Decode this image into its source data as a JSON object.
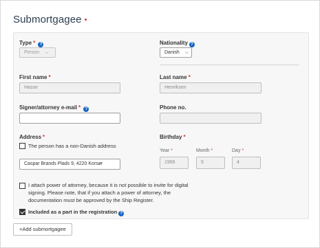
{
  "section": {
    "title": "Submortgagee",
    "required_mark": "•"
  },
  "required_mark": "*",
  "type": {
    "label": "Type",
    "value": "Person",
    "help_icon": "?"
  },
  "nationality": {
    "label": "Nationality",
    "value": "Danish",
    "help_icon": "?"
  },
  "first_name": {
    "label": "First name",
    "value": "Hasse"
  },
  "last_name": {
    "label": "Last name",
    "value": "Henriksen"
  },
  "signer_email": {
    "label": "Signer/attorney e-mail",
    "value": "",
    "help_icon": "?"
  },
  "phone": {
    "label": "Phone no.",
    "value": ""
  },
  "address": {
    "label": "Address",
    "non_danish_label": "The person has a non-Danish address",
    "non_danish_checked": false,
    "value": "Caspar Brands Plads 9, 4220 Korsør"
  },
  "birthday": {
    "label": "Birthday",
    "year_label": "Year",
    "year": "1966",
    "month_label": "Month",
    "month": "5",
    "day_label": "Day",
    "day": "4"
  },
  "power_of_attorney": {
    "checked": false,
    "lines": [
      "I attach power of attorney, because it is not possible to invite for digital",
      "signing. Please note, that if you attach a power of attorney, the",
      "documentation must be approved by the Ship Register."
    ]
  },
  "included_in_registration": {
    "label": "Included as a part in the registration",
    "checked": true,
    "help_icon": "?"
  },
  "add_button": {
    "label": "+Add submortgagee"
  },
  "colors": {
    "accent": "#1565c0",
    "required": "#d9332a",
    "text": "#333333"
  }
}
